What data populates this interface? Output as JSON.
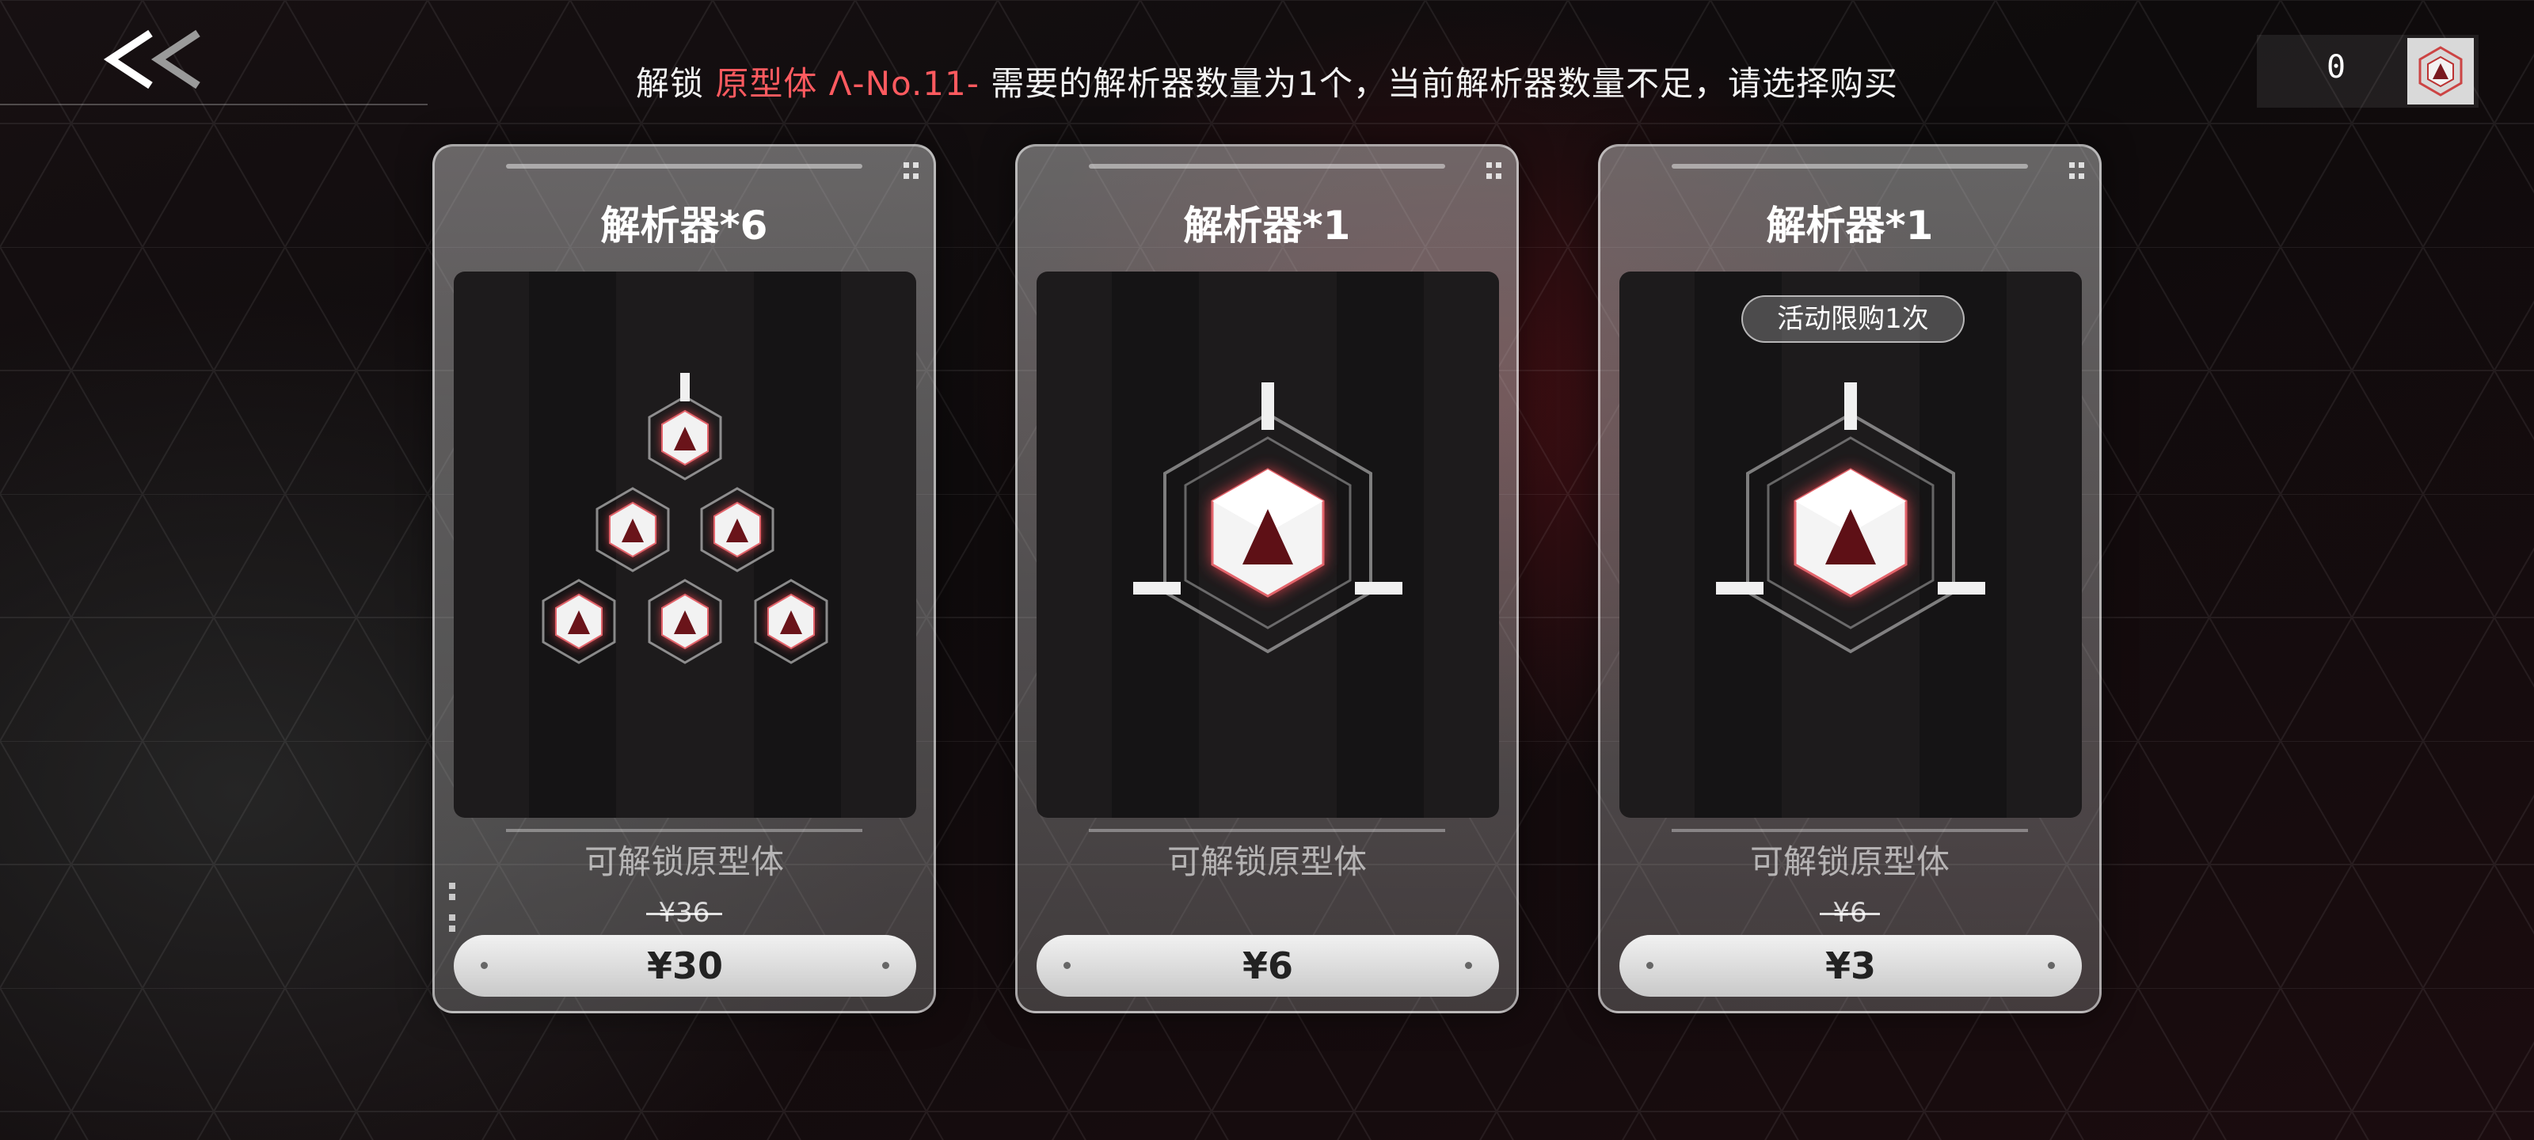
{
  "header": {
    "notice_prefix": "解锁",
    "notice_highlight": "原型体 Λ-No.11-",
    "notice_suffix": "需要的解析器数量为1个，当前解析器数量不足，请选择购买",
    "currency_count": "0",
    "back_icon": "double-chevron-left-icon",
    "currency_icon": "analyzer-cube-icon"
  },
  "cards": [
    {
      "title": "解析器*6",
      "desc": "可解锁原型体",
      "old_price": "¥36",
      "price": "¥30",
      "badge": "",
      "art_icon": "analyzer-cube-cluster-icon"
    },
    {
      "title": "解析器*1",
      "desc": "可解锁原型体",
      "old_price": "",
      "price": "¥6",
      "badge": "",
      "art_icon": "analyzer-cube-icon"
    },
    {
      "title": "解析器*1",
      "desc": "可解锁原型体",
      "old_price": "¥6",
      "price": "¥3",
      "badge": "活动限购1次",
      "art_icon": "analyzer-cube-icon"
    }
  ],
  "colors": {
    "highlight": "#ff5a5f",
    "glow": "#ff4a55",
    "card_border": "#ffffff",
    "price_button": "#e6e6e6"
  }
}
